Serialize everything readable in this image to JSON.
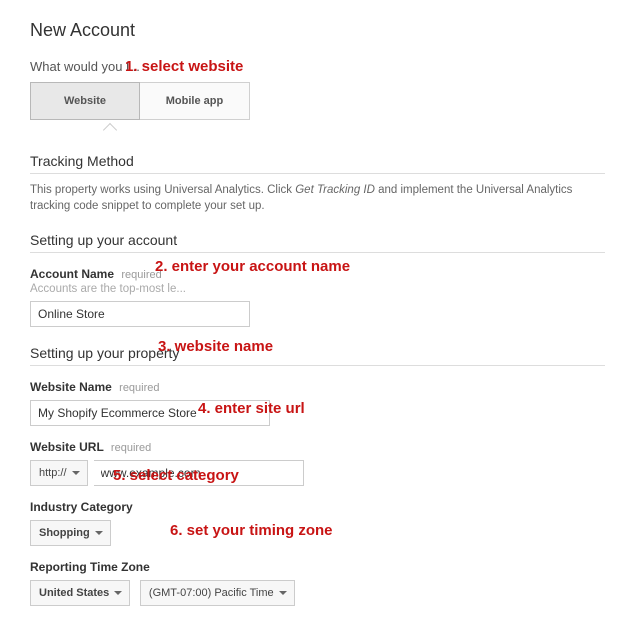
{
  "page": {
    "title": "New Account",
    "question": "What would you l..."
  },
  "tabs": {
    "website": "Website",
    "mobile": "Mobile app"
  },
  "tracking": {
    "heading": "Tracking Method",
    "desc_pre": "This property works using Universal Analytics. Click ",
    "desc_em": "Get Tracking ID",
    "desc_post": " and implement the Universal Analytics tracking code snippet to complete your set up."
  },
  "account_section": {
    "heading": "Setting up your account",
    "name_label": "Account Name",
    "required": "required",
    "hint": "Accounts are the top-most le...",
    "name_value": "Online Store"
  },
  "property_section": {
    "heading": "Setting up your property",
    "site_name_label": "Website Name",
    "site_name_value": "My Shopify Ecommerce Store",
    "site_url_label": "Website URL",
    "protocol": "http://",
    "site_url_value": "www.example.com",
    "industry_label": "Industry Category",
    "industry_value": "Shopping",
    "tz_label": "Reporting Time Zone",
    "tz_country": "United States",
    "tz_value": "(GMT-07:00) Pacific Time"
  },
  "annotations": {
    "a1": "1. select website",
    "a2": "2. enter your account name",
    "a3": "3. website name",
    "a4": "4. enter site url",
    "a5": "5. select category",
    "a6": "6. set your timing zone"
  }
}
